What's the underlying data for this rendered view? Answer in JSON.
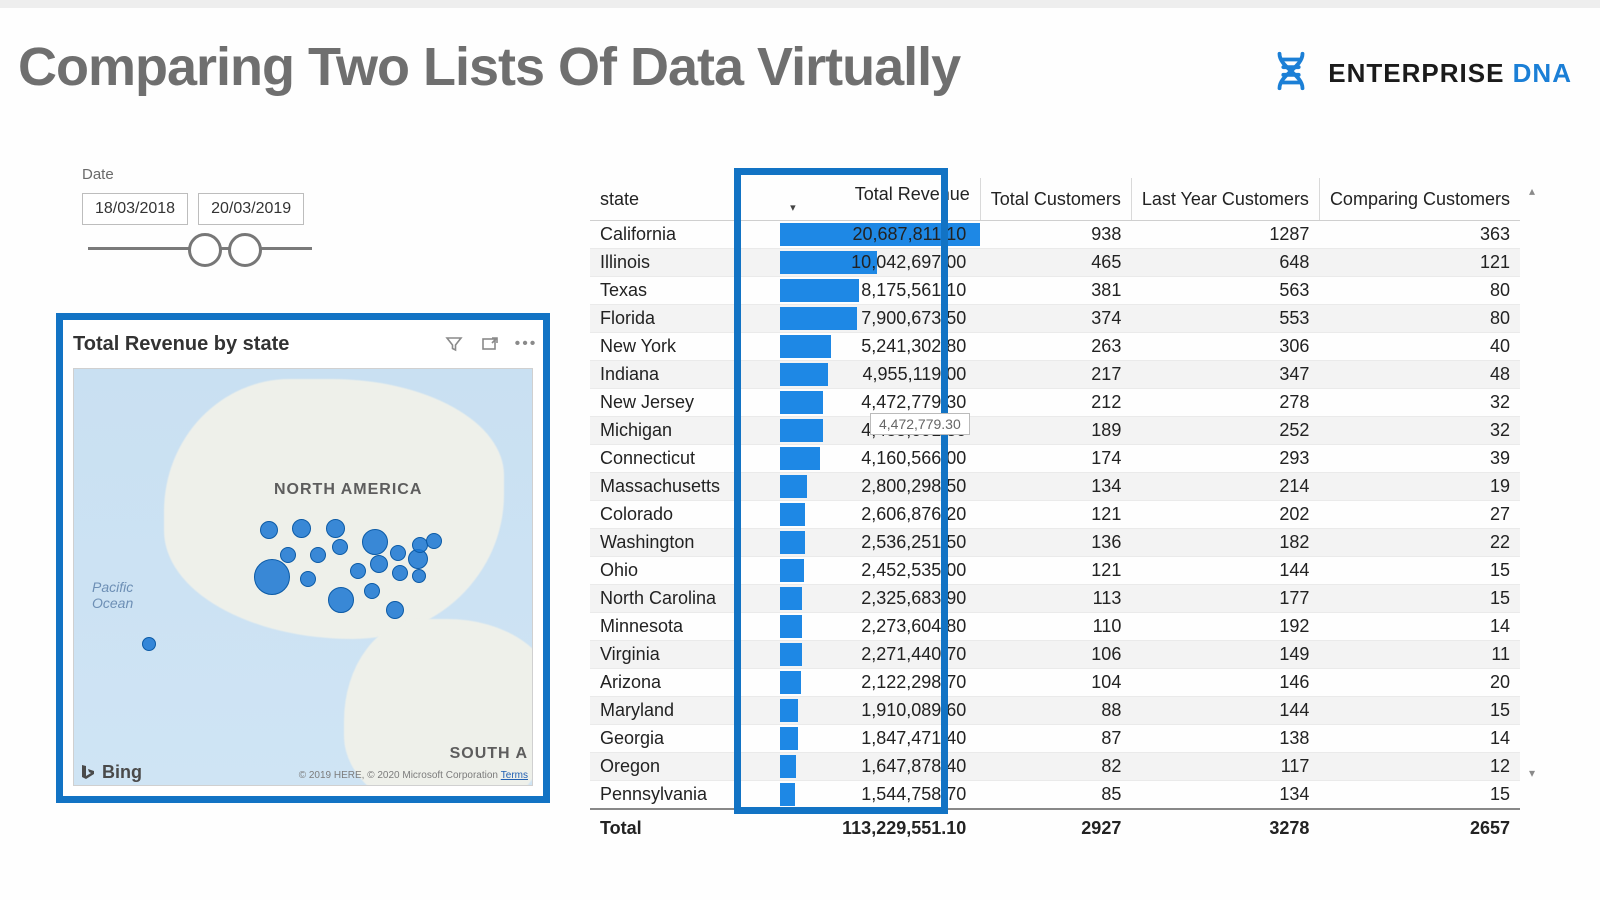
{
  "page": {
    "title": "Comparing Two Lists Of Data Virtually",
    "brand_name": "ENTERPRISE",
    "brand_suffix": "DNA"
  },
  "slicer": {
    "label": "Date",
    "start": "18/03/2018",
    "end": "20/03/2019"
  },
  "map": {
    "title": "Total Revenue by state",
    "continent_label_na": "NORTH AMERICA",
    "continent_label_sa": "SOUTH A",
    "ocean_label": "Pacific\nOcean",
    "provider": "Bing",
    "copyright": "© 2019 HERE, © 2020 Microsoft Corporation",
    "terms": "Terms"
  },
  "table": {
    "headers": {
      "state": "state",
      "revenue": "Total Revenue",
      "total_customers": "Total Customers",
      "last_year": "Last Year Customers",
      "comparing": "Comparing Customers"
    },
    "rows": [
      {
        "state": "California",
        "revenue": "20,687,811.10",
        "tot": "938",
        "ly": "1287",
        "cmp": "363",
        "pct": 100
      },
      {
        "state": "Illinois",
        "revenue": "10,042,697.00",
        "tot": "465",
        "ly": "648",
        "cmp": "121",
        "pct": 48.5
      },
      {
        "state": "Texas",
        "revenue": "8,175,561.10",
        "tot": "381",
        "ly": "563",
        "cmp": "80",
        "pct": 39.5
      },
      {
        "state": "Florida",
        "revenue": "7,900,673.50",
        "tot": "374",
        "ly": "553",
        "cmp": "80",
        "pct": 38.2
      },
      {
        "state": "New York",
        "revenue": "5,241,302.80",
        "tot": "263",
        "ly": "306",
        "cmp": "40",
        "pct": 25.3
      },
      {
        "state": "Indiana",
        "revenue": "4,955,119.00",
        "tot": "217",
        "ly": "347",
        "cmp": "48",
        "pct": 24
      },
      {
        "state": "New Jersey",
        "revenue": "4,472,779.30",
        "tot": "212",
        "ly": "278",
        "cmp": "32",
        "pct": 21.6
      },
      {
        "state": "Michigan",
        "revenue": "4,435,091.80",
        "tot": "189",
        "ly": "252",
        "cmp": "32",
        "pct": 21.4
      },
      {
        "state": "Connecticut",
        "revenue": "4,160,566.00",
        "tot": "174",
        "ly": "293",
        "cmp": "39",
        "pct": 20.1
      },
      {
        "state": "Massachusetts",
        "revenue": "2,800,298.50",
        "tot": "134",
        "ly": "214",
        "cmp": "19",
        "pct": 13.5
      },
      {
        "state": "Colorado",
        "revenue": "2,606,876.20",
        "tot": "121",
        "ly": "202",
        "cmp": "27",
        "pct": 12.6
      },
      {
        "state": "Washington",
        "revenue": "2,536,251.50",
        "tot": "136",
        "ly": "182",
        "cmp": "22",
        "pct": 12.3
      },
      {
        "state": "Ohio",
        "revenue": "2,452,535.00",
        "tot": "121",
        "ly": "144",
        "cmp": "15",
        "pct": 11.9
      },
      {
        "state": "North Carolina",
        "revenue": "2,325,683.90",
        "tot": "113",
        "ly": "177",
        "cmp": "15",
        "pct": 11.2
      },
      {
        "state": "Minnesota",
        "revenue": "2,273,604.80",
        "tot": "110",
        "ly": "192",
        "cmp": "14",
        "pct": 11
      },
      {
        "state": "Virginia",
        "revenue": "2,271,440.70",
        "tot": "106",
        "ly": "149",
        "cmp": "11",
        "pct": 11
      },
      {
        "state": "Arizona",
        "revenue": "2,122,298.70",
        "tot": "104",
        "ly": "146",
        "cmp": "20",
        "pct": 10.3
      },
      {
        "state": "Maryland",
        "revenue": "1,910,089.60",
        "tot": "88",
        "ly": "144",
        "cmp": "15",
        "pct": 9.2
      },
      {
        "state": "Georgia",
        "revenue": "1,847,471.40",
        "tot": "87",
        "ly": "138",
        "cmp": "14",
        "pct": 8.9
      },
      {
        "state": "Oregon",
        "revenue": "1,647,878.40",
        "tot": "82",
        "ly": "117",
        "cmp": "12",
        "pct": 8
      },
      {
        "state": "Pennsylvania",
        "revenue": "1,544,758.70",
        "tot": "85",
        "ly": "134",
        "cmp": "15",
        "pct": 7.5
      }
    ],
    "total": {
      "label": "Total",
      "revenue": "113,229,551.10",
      "tot": "2927",
      "ly": "3278",
      "cmp": "2657"
    },
    "tooltip": "4,472,779.30"
  },
  "chart_data": {
    "type": "table",
    "title": "Total Revenue by state",
    "columns": [
      "state",
      "Total Revenue",
      "Total Customers",
      "Last Year Customers",
      "Comparing Customers"
    ],
    "rows": [
      [
        "California",
        20687811.1,
        938,
        1287,
        363
      ],
      [
        "Illinois",
        10042697.0,
        465,
        648,
        121
      ],
      [
        "Texas",
        8175561.1,
        381,
        563,
        80
      ],
      [
        "Florida",
        7900673.5,
        374,
        553,
        80
      ],
      [
        "New York",
        5241302.8,
        263,
        306,
        40
      ],
      [
        "Indiana",
        4955119.0,
        217,
        347,
        48
      ],
      [
        "New Jersey",
        4472779.3,
        212,
        278,
        32
      ],
      [
        "Michigan",
        4435091.8,
        189,
        252,
        32
      ],
      [
        "Connecticut",
        4160566.0,
        174,
        293,
        39
      ],
      [
        "Massachusetts",
        2800298.5,
        134,
        214,
        19
      ],
      [
        "Colorado",
        2606876.2,
        121,
        202,
        27
      ],
      [
        "Washington",
        2536251.5,
        136,
        182,
        22
      ],
      [
        "Ohio",
        2452535.0,
        121,
        144,
        15
      ],
      [
        "North Carolina",
        2325683.9,
        113,
        177,
        15
      ],
      [
        "Minnesota",
        2273604.8,
        110,
        192,
        14
      ],
      [
        "Virginia",
        2271440.7,
        106,
        149,
        11
      ],
      [
        "Arizona",
        2122298.7,
        104,
        146,
        20
      ],
      [
        "Maryland",
        1910089.6,
        88,
        144,
        15
      ],
      [
        "Georgia",
        1847471.4,
        87,
        138,
        14
      ],
      [
        "Oregon",
        1647878.4,
        82,
        117,
        12
      ],
      [
        "Pennsylvania",
        1544758.7,
        85,
        134,
        15
      ]
    ],
    "totals": [
      "Total",
      113229551.1,
      2927,
      3278,
      2657
    ]
  }
}
